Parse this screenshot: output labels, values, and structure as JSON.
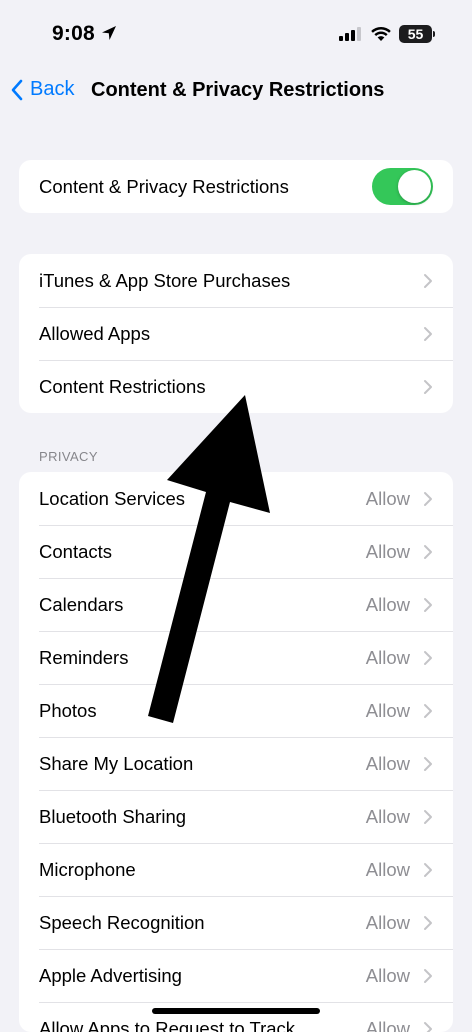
{
  "status_bar": {
    "time": "9:08",
    "battery_level": "55"
  },
  "nav": {
    "back_label": "Back",
    "title": "Content & Privacy Restrictions"
  },
  "master_toggle": {
    "label": "Content & Privacy Restrictions",
    "on": true
  },
  "content_group": [
    {
      "label": "iTunes & App Store Purchases"
    },
    {
      "label": "Allowed Apps"
    },
    {
      "label": "Content Restrictions"
    }
  ],
  "privacy": {
    "header": "PRIVACY",
    "items": [
      {
        "label": "Location Services",
        "value": "Allow"
      },
      {
        "label": "Contacts",
        "value": "Allow"
      },
      {
        "label": "Calendars",
        "value": "Allow"
      },
      {
        "label": "Reminders",
        "value": "Allow"
      },
      {
        "label": "Photos",
        "value": "Allow"
      },
      {
        "label": "Share My Location",
        "value": "Allow"
      },
      {
        "label": "Bluetooth Sharing",
        "value": "Allow"
      },
      {
        "label": "Microphone",
        "value": "Allow"
      },
      {
        "label": "Speech Recognition",
        "value": "Allow"
      },
      {
        "label": "Apple Advertising",
        "value": "Allow"
      },
      {
        "label": "Allow Apps to Request to Track",
        "value": "Allow"
      }
    ]
  },
  "colors": {
    "accent": "#007aff",
    "toggle_on": "#34c759",
    "background": "#f2f2f7",
    "secondary_text": "#8e8e93"
  }
}
